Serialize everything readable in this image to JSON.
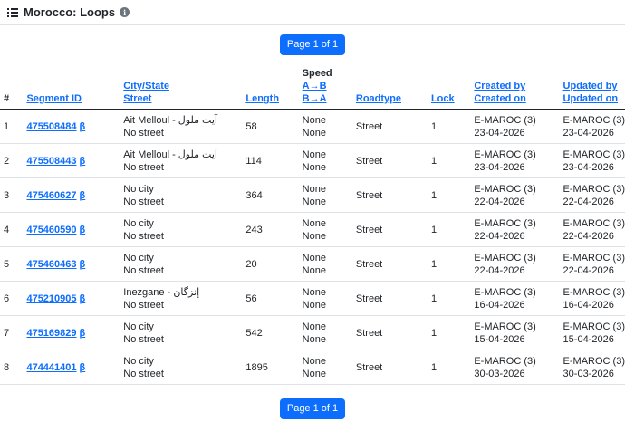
{
  "header": {
    "title": "Morocco: Loops",
    "info_glyph": "i"
  },
  "pager": {
    "label": "Page 1 of 1"
  },
  "columns": {
    "index": "#",
    "segment_id": "Segment ID",
    "city": "City/State",
    "street": "Street",
    "length": "Length",
    "speed": "Speed",
    "speed_ab": "A→B",
    "speed_ba": "B→A",
    "roadtype": "Roadtype",
    "lock": "Lock",
    "created_by": "Created by",
    "created_on": "Created on",
    "updated_by": "Updated by",
    "updated_on": "Updated on"
  },
  "beta": "β",
  "rows": [
    {
      "idx": "1",
      "segment": "475508484",
      "city": "Ait Melloul - آيت ملول",
      "street": "No street",
      "length": "58",
      "ab": "None",
      "ba": "None",
      "roadtype": "Street",
      "lock": "1",
      "created_by": "E-MAROC (3)",
      "created_on": "23-04-2026",
      "updated_by": "E-MAROC (3)",
      "updated_on": "23-04-2026"
    },
    {
      "idx": "2",
      "segment": "475508443",
      "city": "Ait Melloul - آيت ملول",
      "street": "No street",
      "length": "114",
      "ab": "None",
      "ba": "None",
      "roadtype": "Street",
      "lock": "1",
      "created_by": "E-MAROC (3)",
      "created_on": "23-04-2026",
      "updated_by": "E-MAROC (3)",
      "updated_on": "23-04-2026"
    },
    {
      "idx": "3",
      "segment": "475460627",
      "city": "No city",
      "street": "No street",
      "length": "364",
      "ab": "None",
      "ba": "None",
      "roadtype": "Street",
      "lock": "1",
      "created_by": "E-MAROC (3)",
      "created_on": "22-04-2026",
      "updated_by": "E-MAROC (3)",
      "updated_on": "22-04-2026"
    },
    {
      "idx": "4",
      "segment": "475460590",
      "city": "No city",
      "street": "No street",
      "length": "243",
      "ab": "None",
      "ba": "None",
      "roadtype": "Street",
      "lock": "1",
      "created_by": "E-MAROC (3)",
      "created_on": "22-04-2026",
      "updated_by": "E-MAROC (3)",
      "updated_on": "22-04-2026"
    },
    {
      "idx": "5",
      "segment": "475460463",
      "city": "No city",
      "street": "No street",
      "length": "20",
      "ab": "None",
      "ba": "None",
      "roadtype": "Street",
      "lock": "1",
      "created_by": "E-MAROC (3)",
      "created_on": "22-04-2026",
      "updated_by": "E-MAROC (3)",
      "updated_on": "22-04-2026"
    },
    {
      "idx": "6",
      "segment": "475210905",
      "city": "Inezgane - إنزگان",
      "street": "No street",
      "length": "56",
      "ab": "None",
      "ba": "None",
      "roadtype": "Street",
      "lock": "1",
      "created_by": "E-MAROC (3)",
      "created_on": "16-04-2026",
      "updated_by": "E-MAROC (3)",
      "updated_on": "16-04-2026"
    },
    {
      "idx": "7",
      "segment": "475169829",
      "city": "No city",
      "street": "No street",
      "length": "542",
      "ab": "None",
      "ba": "None",
      "roadtype": "Street",
      "lock": "1",
      "created_by": "E-MAROC (3)",
      "created_on": "15-04-2026",
      "updated_by": "E-MAROC (3)",
      "updated_on": "15-04-2026"
    },
    {
      "idx": "8",
      "segment": "474441401",
      "city": "No city",
      "street": "No street",
      "length": "1895",
      "ab": "None",
      "ba": "None",
      "roadtype": "Street",
      "lock": "1",
      "created_by": "E-MAROC (3)",
      "created_on": "30-03-2026",
      "updated_by": "E-MAROC (3)",
      "updated_on": "30-03-2026"
    }
  ]
}
